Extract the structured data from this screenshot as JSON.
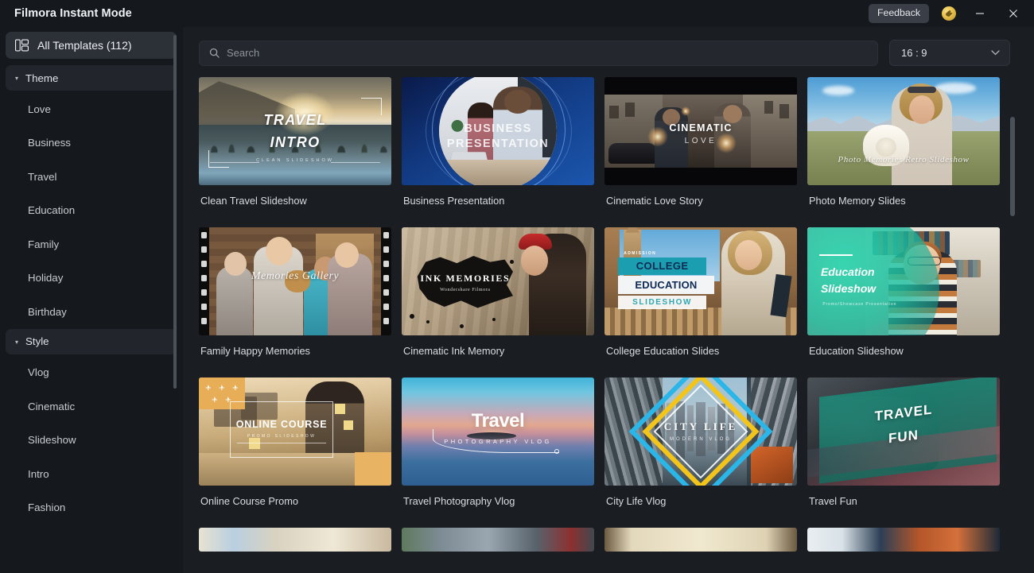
{
  "titlebar": {
    "app_title": "Filmora Instant Mode",
    "feedback_label": "Feedback",
    "coin_icon": "coin-icon",
    "minimize_icon": "minimize-icon",
    "close_icon": "close-icon"
  },
  "sidebar": {
    "all_templates": {
      "label": "All Templates (112)",
      "icon": "templates-grid-icon"
    },
    "groups": [
      {
        "label": "Theme",
        "expanded": true,
        "caret": "▾",
        "items": [
          "Love",
          "Business",
          "Travel",
          "Education",
          "Family",
          "Holiday",
          "Birthday"
        ]
      },
      {
        "label": "Style",
        "expanded": true,
        "caret": "▾",
        "items": [
          "Vlog",
          "Cinematic",
          "Slideshow",
          "Intro",
          "Fashion"
        ]
      }
    ]
  },
  "toolbar": {
    "search": {
      "placeholder": "Search",
      "value": "",
      "icon": "search-icon"
    },
    "aspect_ratio": {
      "value": "16 : 9",
      "chevron": "⌄",
      "icon": "chevron-down-icon"
    }
  },
  "templates": [
    {
      "title": "Clean Travel Slideshow",
      "overlay_title": "TRAVEL",
      "overlay_title2": "INTRO",
      "overlay_sub": "CLEAN SLIDESHOW"
    },
    {
      "title": "Business Presentation",
      "overlay_title": "BUSINESS",
      "overlay_title2": "PRESENTATION"
    },
    {
      "title": "Cinematic Love Story",
      "overlay_title": "CINEMATIC",
      "overlay_title2": "LOVE"
    },
    {
      "title": "Photo Memory Slides",
      "overlay_title": "Photo Memories Retro Slideshow"
    },
    {
      "title": "Family Happy Memories",
      "overlay_title": "Memories Gallery"
    },
    {
      "title": "Cinematic Ink Memory",
      "overlay_title": "INK  MEMORIES",
      "overlay_sub": "Wondershare Filmora"
    },
    {
      "title": "College Education Slides",
      "overlay_small": "ADMISSION",
      "overlay_title": "COLLEGE",
      "overlay_title2": "EDUCATION",
      "overlay_sub": "SLIDESHOW"
    },
    {
      "title": "Education Slideshow",
      "overlay_title": "Education",
      "overlay_title2": "Slideshow",
      "overlay_sub": "Promo/Showcase Presentation"
    },
    {
      "title": "Online Course Promo",
      "overlay_title": "ONLINE COURSE",
      "overlay_sub": "PROMO SLIDESHOW"
    },
    {
      "title": "Travel Photography Vlog",
      "overlay_title": "Travel",
      "overlay_sub": "PHOTOGRAPHY VLOG"
    },
    {
      "title": "City Life Vlog",
      "overlay_title": "CITY LIFE",
      "overlay_sub": "MODERN VLOG"
    },
    {
      "title": "Travel Fun",
      "overlay_title": "TRAVEL",
      "overlay_title2": "FUN"
    }
  ],
  "colors": {
    "window_bg": "#15181c",
    "main_bg": "#1a1e23",
    "pill_active": "#2c3138",
    "group_bg": "#22262c",
    "text_primary": "#e8eaed",
    "text_muted": "#c8ccd2",
    "scrollbar": "#4b5159",
    "feedback_bg": "#3a3f47"
  }
}
